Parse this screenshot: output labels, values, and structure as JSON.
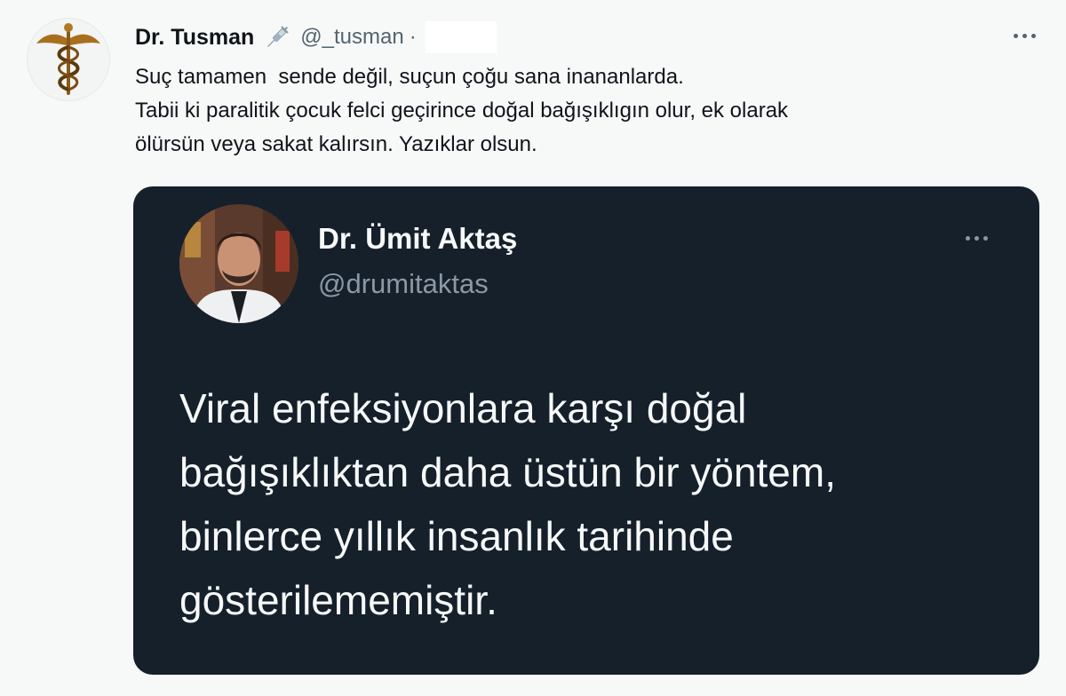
{
  "tweet": {
    "display_name": "Dr. Tusman",
    "name_emoji_icon": "syringe-icon",
    "handle": "@_tusman",
    "separator": "·",
    "text_lines": [
      "Suç tamamen  sende değil, suçun çoğu sana inananlarda.",
      "Tabii ki paralitik çocuk felci geçirince doğal bağışıklıgın olur, ek olarak",
      "ölürsün veya sakat kalırsın. Yazıklar olsun."
    ],
    "more_icon": "more-horizontal-icon",
    "avatar_icon": "caduceus-icon"
  },
  "quoted": {
    "display_name": "Dr. Ümit Aktaş",
    "handle": "@drumitaktas",
    "more_icon": "more-horizontal-icon",
    "body_lines": [
      "Viral enfeksiyonlara karşı doğal",
      "bağışıklıktan daha üstün bir yöntem,",
      "binlerce yıllık insanlık tarihinde",
      "gösterilememiştir."
    ]
  },
  "colors": {
    "page_background": "#f7f9f9",
    "quote_background": "#15202b",
    "secondary_text": "#536471",
    "quote_text": "#f7f9f9"
  }
}
